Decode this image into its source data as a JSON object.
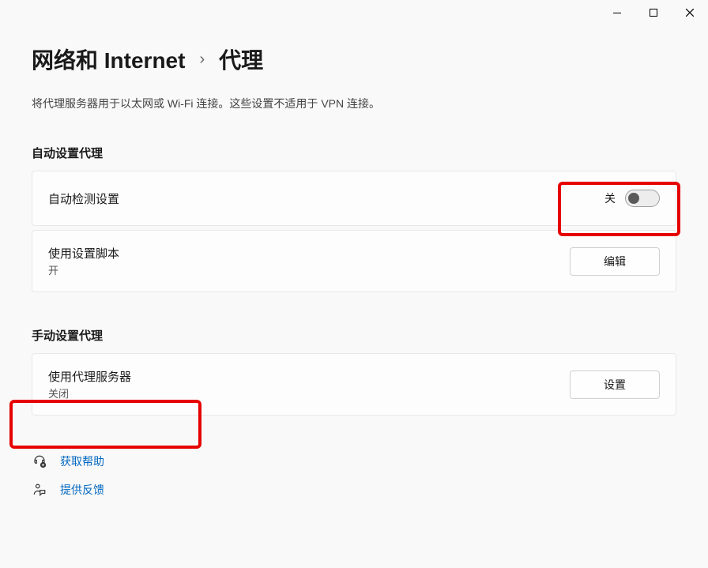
{
  "breadcrumb": {
    "parent": "网络和 Internet",
    "current": "代理"
  },
  "description": "将代理服务器用于以太网或 Wi-Fi 连接。这些设置不适用于 VPN 连接。",
  "sections": {
    "auto": {
      "title": "自动设置代理",
      "detect": {
        "label": "自动检测设置",
        "toggle_state": "关"
      },
      "script": {
        "label": "使用设置脚本",
        "status": "开",
        "button": "编辑"
      }
    },
    "manual": {
      "title": "手动设置代理",
      "server": {
        "label": "使用代理服务器",
        "status": "关闭",
        "button": "设置"
      }
    }
  },
  "links": {
    "help": "获取帮助",
    "feedback": "提供反馈"
  }
}
